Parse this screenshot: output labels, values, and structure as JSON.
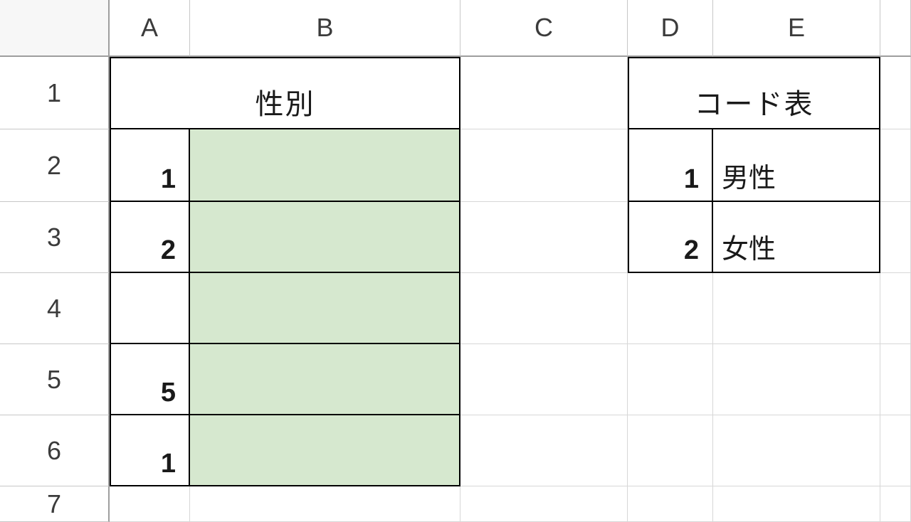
{
  "columns": [
    "A",
    "B",
    "C",
    "D",
    "E"
  ],
  "rows": [
    "1",
    "2",
    "3",
    "4",
    "5",
    "6",
    "7"
  ],
  "region1": {
    "header": "性別",
    "cells": {
      "A2": "1",
      "A3": "2",
      "A4": "",
      "A5": "5",
      "A6": "1",
      "B2": "",
      "B3": "",
      "B4": "",
      "B5": "",
      "B6": ""
    }
  },
  "region2": {
    "header": "コード表",
    "cells": {
      "D2": "1",
      "E2": "男性",
      "D3": "2",
      "E3": "女性"
    }
  }
}
